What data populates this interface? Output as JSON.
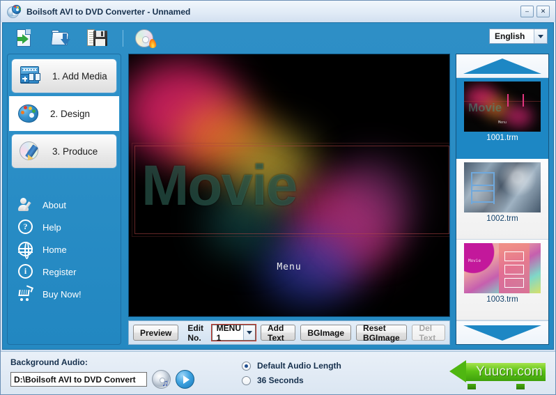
{
  "window": {
    "title": "Boilsoft AVI to DVD Converter  -  Unnamed",
    "app_icon": "cd-palette-icon",
    "minimize_label": "–",
    "close_label": "✕"
  },
  "toolbar": {
    "icons": [
      {
        "name": "new-project-icon",
        "title": "New Project"
      },
      {
        "name": "open-project-icon",
        "title": "Open Project"
      },
      {
        "name": "save-project-icon",
        "title": "Save Project"
      },
      {
        "name": "burn-disc-icon",
        "title": "Burn"
      }
    ],
    "language": {
      "value": "English",
      "chevron": "chevron-down-icon"
    }
  },
  "sidebar": {
    "steps": [
      {
        "label": "1. Add Media",
        "icon": "film-add-icon",
        "state": "inactive"
      },
      {
        "label": "2. Design",
        "icon": "palette-icon",
        "state": "active"
      },
      {
        "label": "3. Produce",
        "icon": "disc-pencil-icon",
        "state": "inactive"
      }
    ],
    "menu": [
      {
        "label": "About",
        "icon": "user-edit-icon"
      },
      {
        "label": "Help",
        "icon": "question-circle-icon"
      },
      {
        "label": "Home",
        "icon": "globe-icon"
      },
      {
        "label": "Register",
        "icon": "info-circle-icon"
      },
      {
        "label": "Buy Now!",
        "icon": "shopping-cart-icon"
      }
    ],
    "help_glyph": "?",
    "register_glyph": "i"
  },
  "preview": {
    "movie_text": "Movie",
    "menu_text": "Menu"
  },
  "edit_bar": {
    "preview_label": "Preview",
    "edit_no_label": "Edit No.",
    "menu_select_value": "MENU 1",
    "add_text_label": "Add Text",
    "bgimage_label": "BGImage",
    "reset_bgimage_label": "Reset BGImage",
    "del_text_label": "Del Text",
    "del_text_enabled": false
  },
  "thumbnails": {
    "scroll_up_icon": "triangle-up-icon",
    "scroll_down_icon": "triangle-down-icon",
    "items": [
      {
        "name": "1001.trm",
        "selected": true
      },
      {
        "name": "1002.trm",
        "selected": false
      },
      {
        "name": "1003.trm",
        "selected": false
      }
    ],
    "thumb1_movie_text": "Movie",
    "thumb1_menu_text": "Menu",
    "thumb3_text": "Movie"
  },
  "audio": {
    "label": "Background Audio:",
    "path_value": "D:\\Boilsoft AVI to DVD Convert",
    "cd_button_icon": "cd-music-icon",
    "play_button_icon": "play-icon",
    "music_note": "♫",
    "options": [
      {
        "label": "Default Audio Length",
        "selected": true
      },
      {
        "label": "36 Seconds",
        "selected": false
      }
    ]
  },
  "watermark": {
    "text": "Yuucn.com"
  }
}
